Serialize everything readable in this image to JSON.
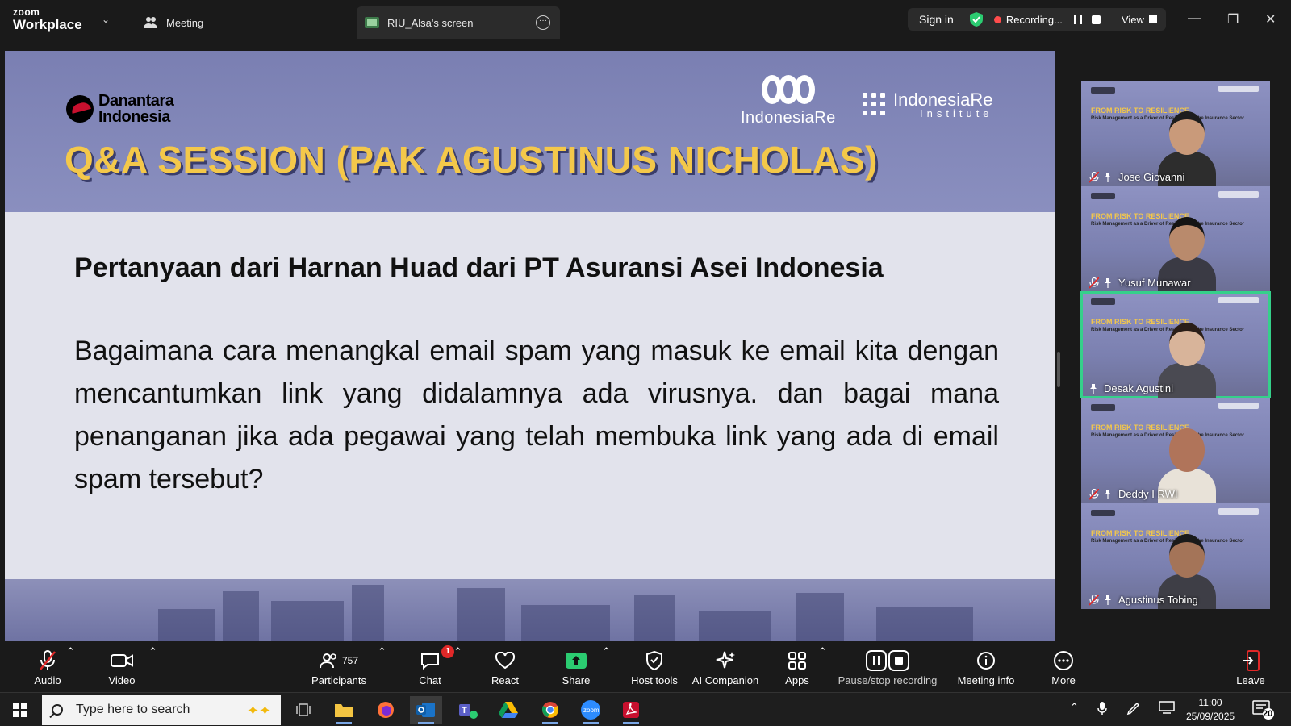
{
  "window": {
    "logo_top": "zoom",
    "logo_bottom": "Workplace",
    "tabs": [
      {
        "label": "Meeting",
        "icon": "people-icon"
      },
      {
        "label": "RIU_Alsa's screen",
        "icon": "screen-share-icon"
      }
    ],
    "sign_in": "Sign in",
    "recording_label": "Recording...",
    "view_label": "View",
    "accent_green": "#35d08a",
    "record_red": "#ff4c4c"
  },
  "slide": {
    "org_left": "Danantara\nIndonesia",
    "org_left_line1": "Danantara",
    "org_left_line2": "Indonesia",
    "org_mid": "IndonesiaRe",
    "org_right_line1": "IndonesiaRe",
    "org_right_line2": "Institute",
    "title": "Q&A SESSION (PAK AGUSTINUS NICHOLAS)",
    "question_from": "Pertanyaan dari Harnan Huad dari PT Asuransi Asei Indonesia",
    "question_body": "Bagaimana cara menangkal email spam yang masuk ke email kita dengan mencantumkan link yang didalamnya ada virusnya. dan bagai mana penanganan jika ada pegawai yang telah membuka link yang ada di email spam tersebut?",
    "title_color": "#f4c84a"
  },
  "participants_strip": {
    "mini_heading": "FROM RISK TO RESILIENCE",
    "mini_sub": "Risk Management as a Driver of Resilience in the Insurance Sector",
    "tiles": [
      {
        "name": "Jose Giovanni",
        "muted": true,
        "active": false,
        "skin": "#c99a7a",
        "shirt": "#2d2d2d",
        "hair": "#1d1d1d"
      },
      {
        "name": "Yusuf Munawar",
        "muted": true,
        "active": false,
        "skin": "#b98a6c",
        "shirt": "#3a3a44",
        "hair": "#141414"
      },
      {
        "name": "Desak Agustini",
        "muted": false,
        "active": true,
        "skin": "#d8b49a",
        "shirt": "#4a4a52",
        "hair": "#2a1e18"
      },
      {
        "name": "Deddy I RWI",
        "muted": true,
        "active": false,
        "skin": "#b0745a",
        "shirt": "#e8e2d8",
        "hair": "#b0745a"
      },
      {
        "name": "Agustinus Tobing",
        "muted": true,
        "active": false,
        "skin": "#a47458",
        "shirt": "#3e3e46",
        "hair": "#1a1a1a"
      }
    ]
  },
  "toolbar": {
    "audio": "Audio",
    "video": "Video",
    "participants": "Participants",
    "participants_count": "757",
    "chat": "Chat",
    "chat_badge": "1",
    "react": "React",
    "share": "Share",
    "host_tools": "Host tools",
    "ai_companion": "AI Companion",
    "apps": "Apps",
    "pause_recording": "Pause/stop recording",
    "meeting_info": "Meeting info",
    "more": "More",
    "leave": "Leave"
  },
  "taskbar": {
    "search_placeholder": "Type here to search",
    "time": "11:00",
    "date": "25/09/2025",
    "notifications": "20"
  }
}
